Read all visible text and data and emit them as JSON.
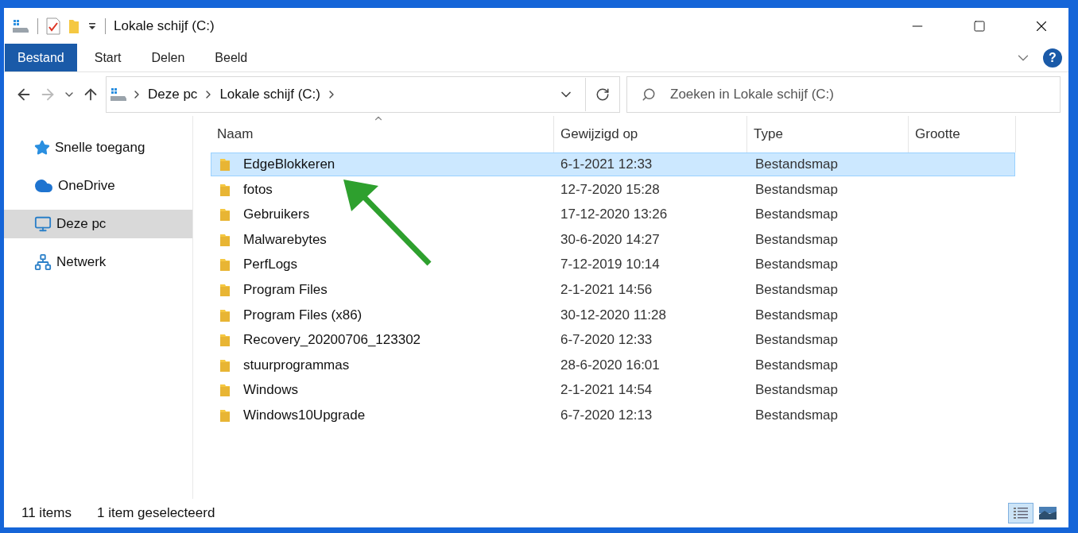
{
  "window": {
    "title": "Lokale schijf (C:)"
  },
  "ribbon_tabs": [
    {
      "label": "Bestand",
      "selected": true
    },
    {
      "label": "Start",
      "selected": false
    },
    {
      "label": "Delen",
      "selected": false
    },
    {
      "label": "Beeld",
      "selected": false
    }
  ],
  "help": {
    "label": "?"
  },
  "address": {
    "crumbs": [
      "Deze pc",
      "Lokale schijf (C:)"
    ]
  },
  "search": {
    "placeholder": "Zoeken in Lokale schijf (C:)"
  },
  "sidebar": {
    "items": [
      {
        "label": "Snelle toegang",
        "kind": "star",
        "selected": false
      },
      {
        "label": "OneDrive",
        "kind": "cloud",
        "selected": false
      },
      {
        "label": "Deze pc",
        "kind": "pc",
        "selected": true
      },
      {
        "label": "Netwerk",
        "kind": "network",
        "selected": false
      }
    ]
  },
  "table": {
    "columns": [
      "Naam",
      "Gewijzigd op",
      "Type",
      "Grootte"
    ],
    "rows": [
      {
        "name": "EdgeBlokkeren",
        "modified": "6-1-2021 12:33",
        "type": "Bestandsmap",
        "selected": true
      },
      {
        "name": "fotos",
        "modified": "12-7-2020 15:28",
        "type": "Bestandsmap",
        "selected": false
      },
      {
        "name": "Gebruikers",
        "modified": "17-12-2020 13:26",
        "type": "Bestandsmap",
        "selected": false
      },
      {
        "name": "Malwarebytes",
        "modified": "30-6-2020 14:27",
        "type": "Bestandsmap",
        "selected": false
      },
      {
        "name": "PerfLogs",
        "modified": "7-12-2019 10:14",
        "type": "Bestandsmap",
        "selected": false
      },
      {
        "name": "Program Files",
        "modified": "2-1-2021 14:56",
        "type": "Bestandsmap",
        "selected": false
      },
      {
        "name": "Program Files (x86)",
        "modified": "30-12-2020 11:28",
        "type": "Bestandsmap",
        "selected": false
      },
      {
        "name": "Recovery_20200706_123302",
        "modified": "6-7-2020 12:33",
        "type": "Bestandsmap",
        "selected": false
      },
      {
        "name": "stuurprogrammas",
        "modified": "28-6-2020 16:01",
        "type": "Bestandsmap",
        "selected": false
      },
      {
        "name": "Windows",
        "modified": "2-1-2021 14:54",
        "type": "Bestandsmap",
        "selected": false
      },
      {
        "name": "Windows10Upgrade",
        "modified": "6-7-2020 12:13",
        "type": "Bestandsmap",
        "selected": false
      }
    ]
  },
  "status_bar": {
    "count": "11 items",
    "selection": "1 item geselecteerd"
  },
  "view_buttons": [
    {
      "kind": "details",
      "selected": true
    },
    {
      "kind": "large-icons",
      "selected": false
    }
  ]
}
